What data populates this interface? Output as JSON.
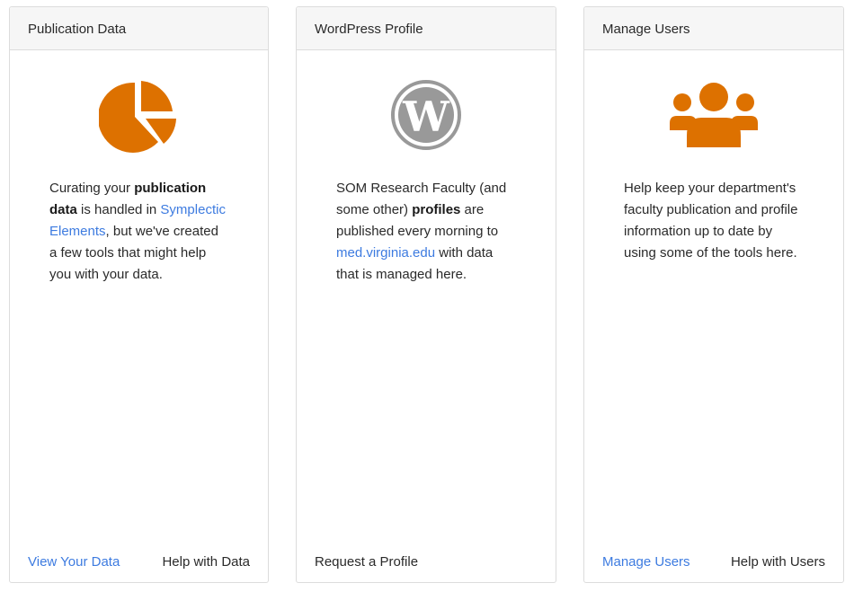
{
  "colors": {
    "accent": "#dd7100",
    "wordpress_gray": "#999999",
    "link": "#3d7be0"
  },
  "cards": [
    {
      "title": "Publication Data",
      "icon": "pie-chart-icon",
      "text": {
        "p1": "Curating your ",
        "b1": "publication data",
        "p2": " is handled in ",
        "link": "Symplectic Elements",
        "p3": ", but we've created a few tools that might help you with your data."
      },
      "footer": {
        "left": "View Your Data",
        "right": "Help with Data"
      }
    },
    {
      "title": "WordPress Profile",
      "icon": "wordpress-icon",
      "text": {
        "p1": "SOM Research Faculty (and some other) ",
        "b1": "profiles",
        "p2": " are published every morning to ",
        "link": "med.virginia.edu",
        "p3": " with data that is managed here."
      },
      "footer": {
        "left": "Request a Profile"
      }
    },
    {
      "title": "Manage Users",
      "icon": "users-icon",
      "text": {
        "p1": "Help keep your department's faculty publication and profile information up to date by using some of the tools here."
      },
      "footer": {
        "left": "Manage Users",
        "right": "Help with Users"
      }
    }
  ]
}
